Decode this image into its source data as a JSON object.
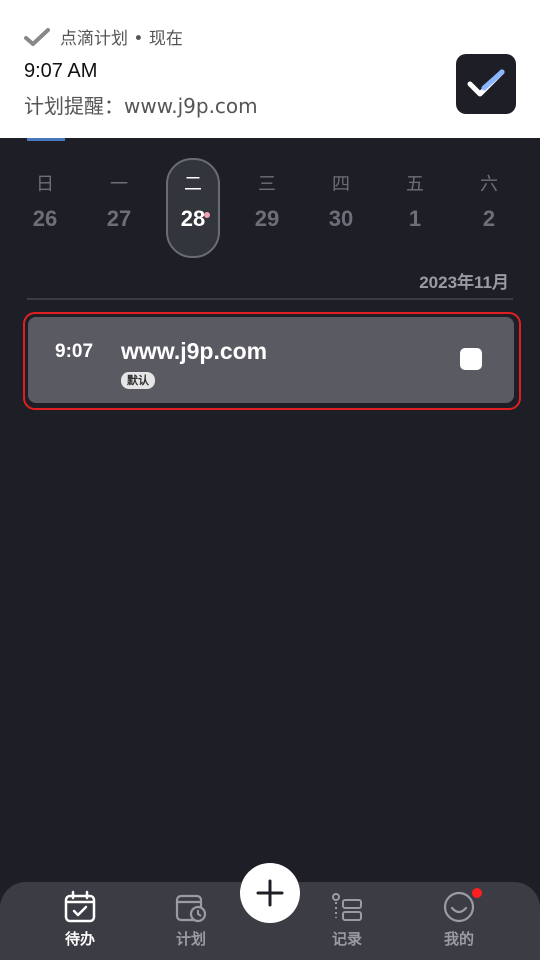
{
  "notification": {
    "app_name": "点滴计划 • 现在",
    "time": "9:07 AM",
    "body": "计划提醒：www.j9p.com"
  },
  "week": {
    "days": [
      {
        "weekday": "日",
        "date": "26"
      },
      {
        "weekday": "一",
        "date": "27"
      },
      {
        "weekday": "二",
        "date": "28"
      },
      {
        "weekday": "三",
        "date": "29"
      },
      {
        "weekday": "四",
        "date": "30"
      },
      {
        "weekday": "五",
        "date": "1"
      },
      {
        "weekday": "六",
        "date": "2"
      }
    ],
    "selected_index": 2,
    "month_label": "2023年11月"
  },
  "task": {
    "time": "9:07",
    "title": "www.j9p.com",
    "tag": "默认"
  },
  "nav": {
    "items": [
      {
        "label": "待办",
        "icon": "calendar-check-icon"
      },
      {
        "label": "计划",
        "icon": "calendar-clock-icon"
      },
      {
        "label": "记录",
        "icon": "list-icon"
      },
      {
        "label": "我的",
        "icon": "smile-icon"
      }
    ],
    "add_icon": "plus-icon"
  },
  "colors": {
    "background": "#1e1f26",
    "card": "#5a5b62",
    "highlight_outline": "#e02020",
    "badge": "#ff1f1f"
  }
}
